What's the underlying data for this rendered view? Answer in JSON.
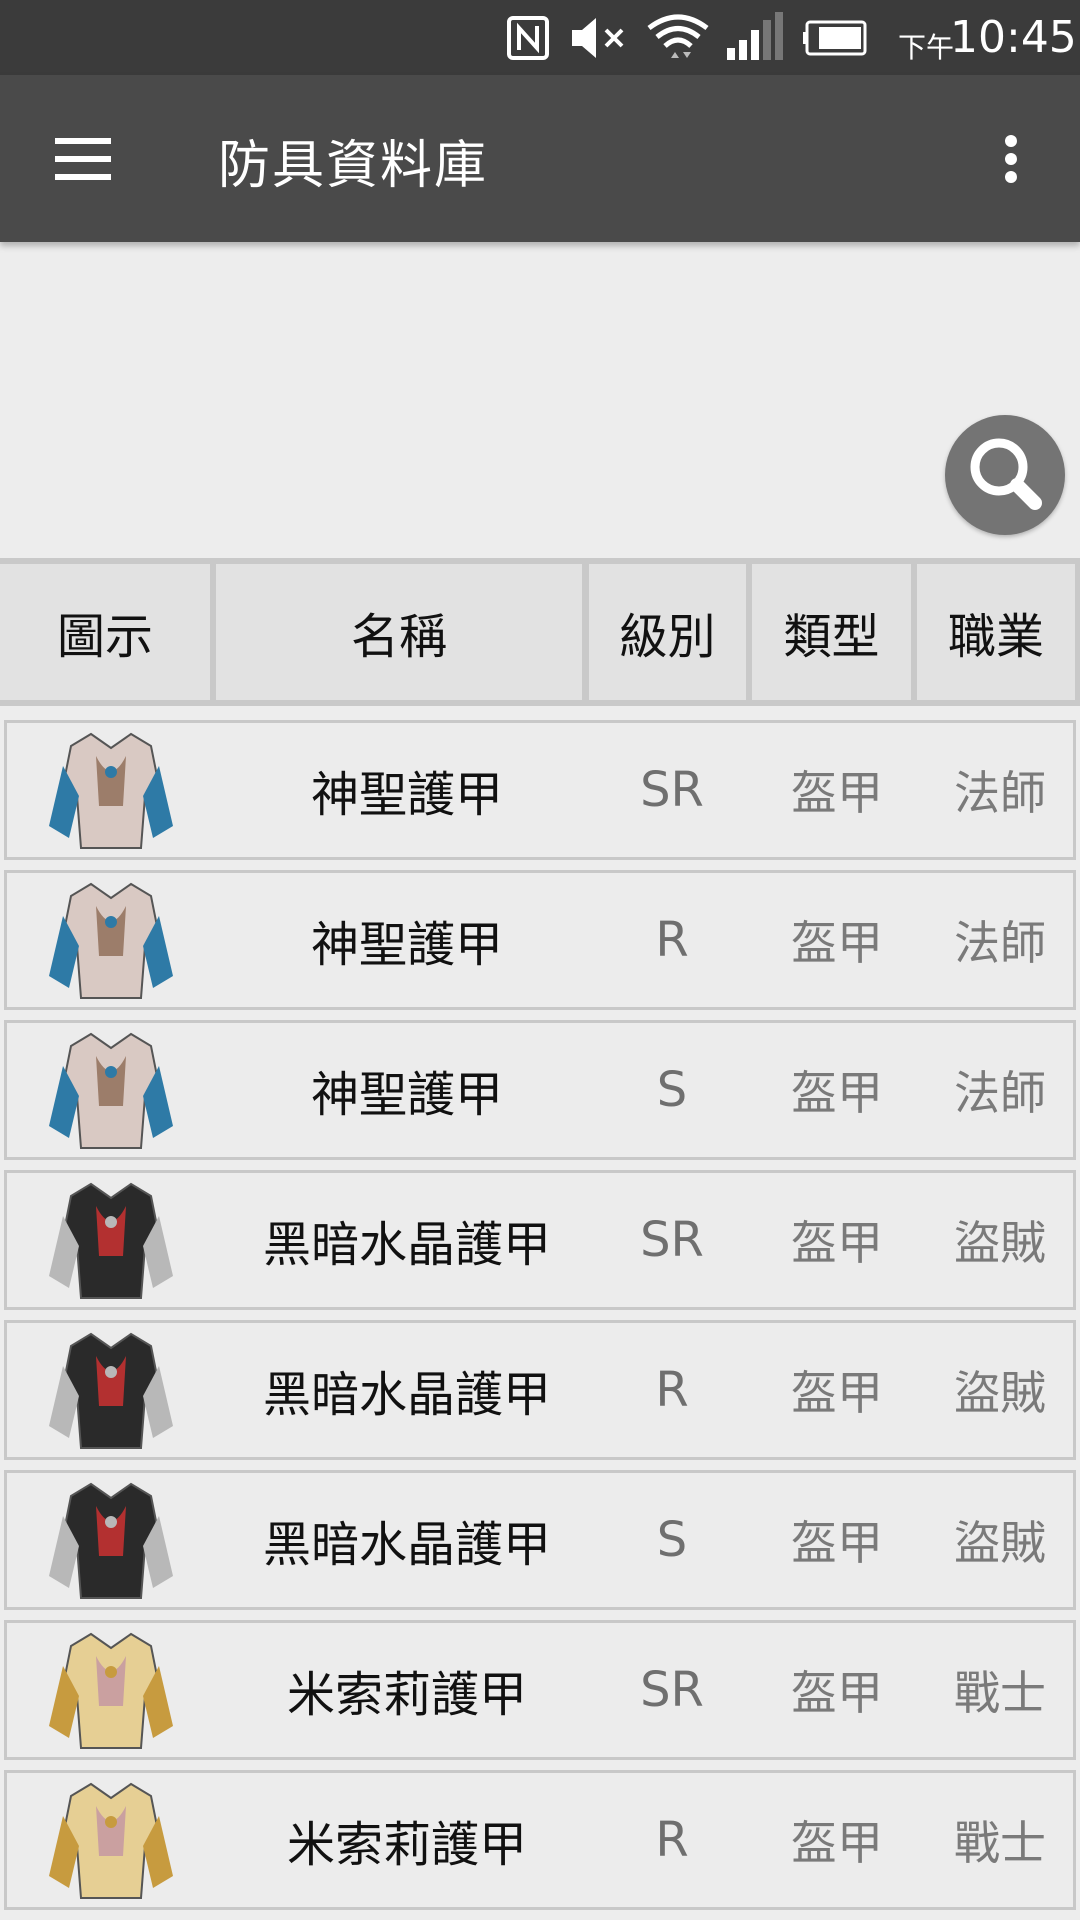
{
  "status_bar": {
    "time_prefix": "下午",
    "time": "10:45",
    "icons": [
      "nfc-icon",
      "mute-icon",
      "wifi-icon",
      "signal-icon",
      "battery-icon"
    ]
  },
  "app_bar": {
    "title": "防具資料庫",
    "menu_icon": "hamburger-menu-icon",
    "overflow_icon": "more-vert-icon"
  },
  "search": {
    "icon": "search-icon"
  },
  "table": {
    "headers": [
      "圖示",
      "名稱",
      "級別",
      "類型",
      "職業"
    ],
    "rows": [
      {
        "icon": "mage-armor",
        "name": "神聖護甲",
        "rank": "SR",
        "type": "盔甲",
        "class": "法師"
      },
      {
        "icon": "mage-armor",
        "name": "神聖護甲",
        "rank": "R",
        "type": "盔甲",
        "class": "法師"
      },
      {
        "icon": "mage-armor",
        "name": "神聖護甲",
        "rank": "S",
        "type": "盔甲",
        "class": "法師"
      },
      {
        "icon": "dark-armor",
        "name": "黑暗水晶護甲",
        "rank": "SR",
        "type": "盔甲",
        "class": "盜賊"
      },
      {
        "icon": "dark-armor",
        "name": "黑暗水晶護甲",
        "rank": "R",
        "type": "盔甲",
        "class": "盜賊"
      },
      {
        "icon": "dark-armor",
        "name": "黑暗水晶護甲",
        "rank": "S",
        "type": "盔甲",
        "class": "盜賊"
      },
      {
        "icon": "gold-armor",
        "name": "米索莉護甲",
        "rank": "SR",
        "type": "盔甲",
        "class": "戰士"
      },
      {
        "icon": "gold-armor",
        "name": "米索莉護甲",
        "rank": "R",
        "type": "盔甲",
        "class": "戰士"
      }
    ]
  },
  "colors": {
    "mage-armor": {
      "body": "#d9c9c3",
      "accent": "#2e7aa6",
      "trim": "#9c7d6a"
    },
    "dark-armor": {
      "body": "#2a2a2a",
      "accent": "#b8b8b8",
      "trim": "#b33030"
    },
    "gold-armor": {
      "body": "#e6cf94",
      "accent": "#c79b3f",
      "trim": "#caa0a0"
    }
  }
}
